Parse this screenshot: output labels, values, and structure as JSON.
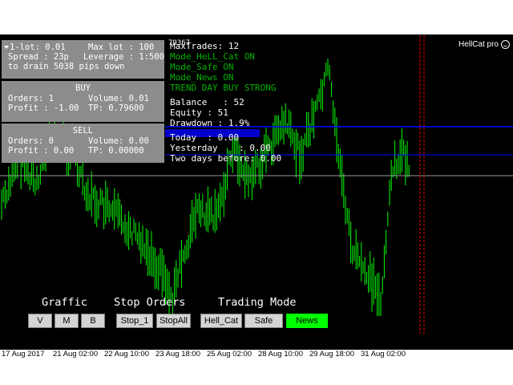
{
  "ea": {
    "title": "HellCat pro"
  },
  "ghost_text": "79367",
  "panel_top": {
    "lot": "1-lot: 0.01",
    "max_lot": "Max lot : 100",
    "spread": "Spread  : 23p",
    "leverage": "Leverage : 1:500",
    "drain": "to drain 5038 pips down"
  },
  "buy": {
    "title": "BUY",
    "orders": "Orders: 1",
    "volume": "Volume: 0.01",
    "profit": "Profit : -1.00",
    "tp": "TP: 0.79600"
  },
  "sell": {
    "title": "SELL",
    "orders": "Orders: 0",
    "volume": "Volume: 0.00",
    "profit": "Profit : 0.00",
    "tp": "TP: 0.00000"
  },
  "info": {
    "maxtrades": "MaxTrades: 12",
    "mode_hellcat": "Mode_HeLL_Cat ON",
    "mode_safe": "Mode_Safe ON",
    "mode_news": "Mode_News ON",
    "trend": "TREND DAY BUY STRONG",
    "balance": "Balance   : 52",
    "equity": "Equity : 51",
    "drawdown": "Drawdown : 1.9%",
    "today": "Today  : 0.00",
    "yesterday": "Yesterday    : 0.00",
    "two_days": "Two days before: 0.00"
  },
  "sections": {
    "graffic": "Graffic",
    "stop_orders": "Stop Orders",
    "trading_mode": "Trading Mode"
  },
  "buttons": {
    "v": "V",
    "m": "M",
    "b": "B",
    "stop1": "Stop_1",
    "stopall": "StopAll",
    "hellcat": "Hell_Cat",
    "safe": "Safe",
    "news": "News"
  },
  "colors": {
    "bar": "#00ff00",
    "active_button": "#00ff00",
    "level_line": "#0000ff",
    "bid_line": "#9a9a9a",
    "period_separator": "#ff0000"
  },
  "xaxis": {
    "labels": [
      "17 Aug 2017",
      "21 Aug 02:00",
      "22 Aug 10:00",
      "23 Aug 18:00",
      "25 Aug 02:00",
      "28 Aug 10:00",
      "29 Aug 18:00",
      "31 Aug 02:00"
    ]
  }
}
